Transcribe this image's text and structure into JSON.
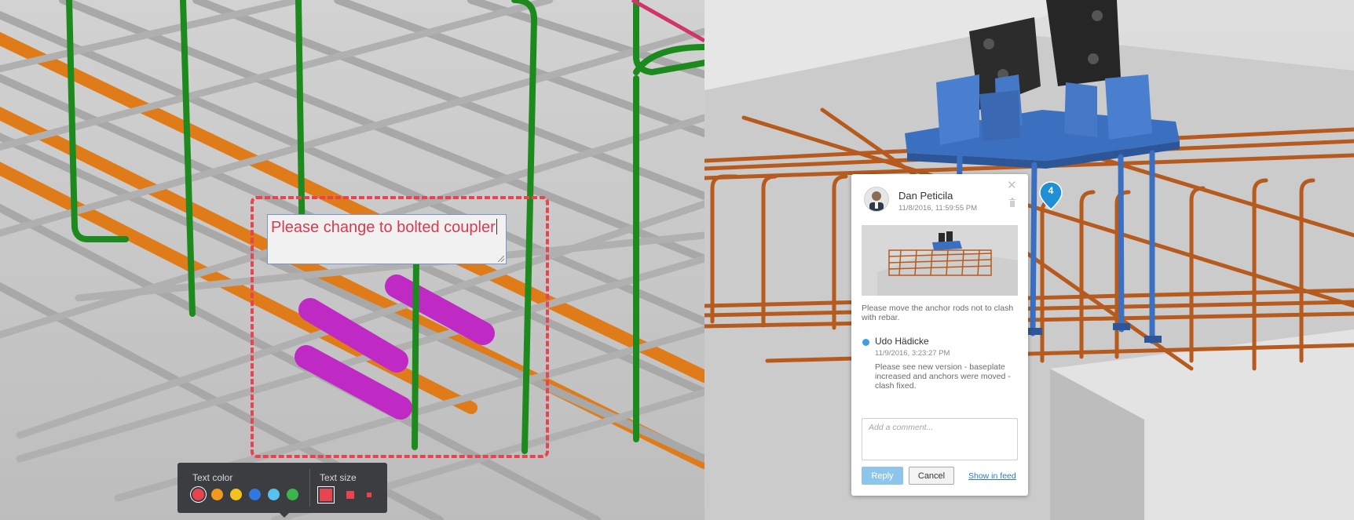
{
  "markup": {
    "text": "Please change to bolted coupler"
  },
  "toolbar": {
    "text_color_label": "Text color",
    "text_size_label": "Text size",
    "colors": [
      {
        "name": "red",
        "hex": "#e8434f",
        "selected": true
      },
      {
        "name": "orange",
        "hex": "#f39a1e",
        "selected": false
      },
      {
        "name": "yellow",
        "hex": "#f4c21c",
        "selected": false
      },
      {
        "name": "blue",
        "hex": "#2f78e0",
        "selected": false
      },
      {
        "name": "light-blue",
        "hex": "#56c2ee",
        "selected": false
      },
      {
        "name": "green",
        "hex": "#3cb54a",
        "selected": false
      }
    ],
    "sizes": [
      "large",
      "medium",
      "small"
    ],
    "selected_size": "large"
  },
  "comment": {
    "author": "Dan Peticila",
    "date": "11/8/2016, 11:59:55 PM",
    "body": "Please move the anchor rods not to clash with rebar.",
    "reply": {
      "author": "Udo Hädicke",
      "date": "11/9/2016, 3:23:27 PM",
      "body": "Please see new version - baseplate increased and anchors were moved - clash fixed."
    },
    "input_placeholder": "Add a comment...",
    "reply_label": "Reply",
    "cancel_label": "Cancel",
    "feed_link": "Show in feed",
    "pin_number": "4"
  },
  "colors": {
    "markup_red": "#e8434f",
    "rebar_grey": "#a8a8a8",
    "rebar_green": "#1d8a1d",
    "rebar_orange": "#e07a14",
    "coupler_magenta": "#c02ac4",
    "steel_blue": "#3b6fc0",
    "rust_rebar": "#b65a1e",
    "accent_blue": "#2a79c2"
  }
}
